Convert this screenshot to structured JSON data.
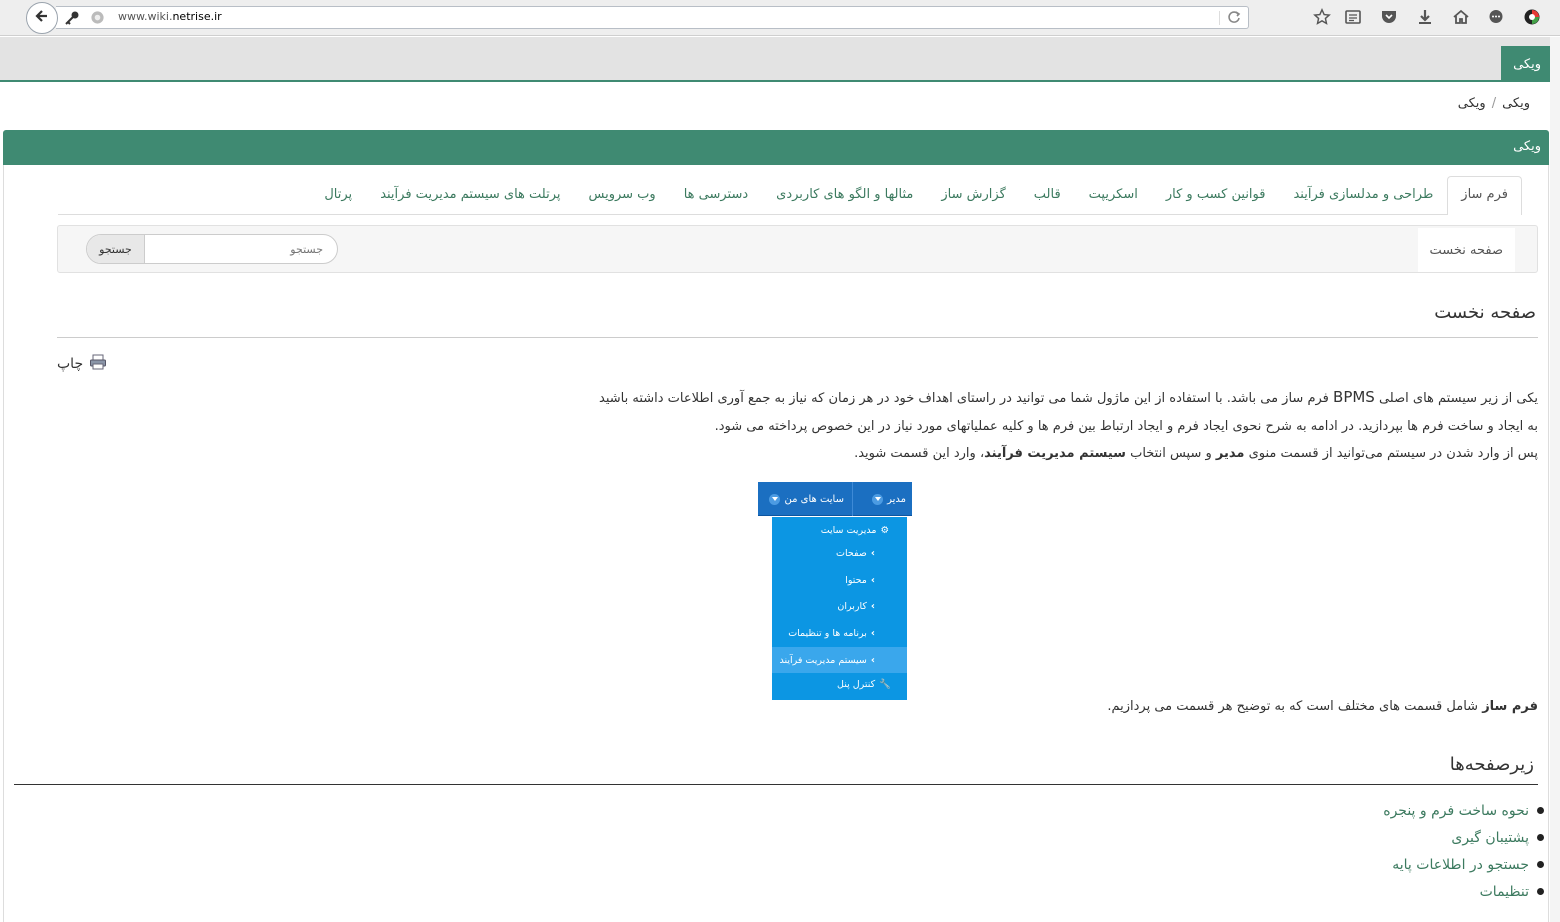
{
  "browser": {
    "url_prefix": "www.wiki.",
    "url_domain": "netrise.ir"
  },
  "topnav": {
    "tab": "ویکی"
  },
  "breadcrumb": {
    "items": [
      "ویکی",
      "ویکی"
    ],
    "sep": "/"
  },
  "panel": {
    "title": "ویکی"
  },
  "tabs": [
    "فرم ساز",
    "طراحی و مدلسازی فرآیند",
    "قوانین کسب و کار",
    "اسکریپت",
    "قالب",
    "گزارش ساز",
    "مثالها و الگو های کاربردی",
    "دسترسی ها",
    "وب سرویس",
    "پرتلت های سیستم مدیریت فرآیند",
    "پرتال"
  ],
  "subbar": {
    "home_label": "صفحه نخست",
    "search_placeholder": "جستجو",
    "search_button": "جستجو"
  },
  "page": {
    "title": "صفحه نخست",
    "print_label": "چاپ",
    "para1_a": "یکی از زیر سیستم های اصلی ",
    "para1_big": "BPMS",
    "para1_b": " فرم ساز می باشد. با استفاده از این ماژول شما می توانید در راستای اهداف خود در هر زمان که نیاز به جمع آوری اطلاعات داشته باشید",
    "para2": "به ایجاد و ساخت فرم ها بپردازید. در ادامه به شرح نحوی ایجاد فرم و ایجاد ارتباط بین فرم ها و کلیه عملیاتهای مورد نیاز در این خصوص پرداخته می شود.",
    "para3_a": "پس از وارد شدن در سیستم می‌توانید از قسمت  منوی ",
    "para3_b1": "مدیر",
    "para3_c": " و سپس انتخاب ",
    "para3_b2": "سیستم مدیریت فرآیند",
    "para3_d": "، وارد این قسمت شوید.",
    "para4_bold": "فرم ساز",
    "para4_rest": " شامل قسمت های مختلف است که به توضیح هر قسمت می پردازیم."
  },
  "menu_image": {
    "top_right": "مدیر",
    "top_left": "سایت های من",
    "items": [
      "مدیریت سایت",
      "صفحات",
      "محتوا",
      "کاربران",
      "برنامه ها و تنظیمات",
      "سیستم مدیریت فرآیند",
      "کنترل پنل"
    ]
  },
  "subpages": {
    "title": "زیرصفحه‌ها",
    "items": [
      "نحوه ساخت فرم و پنجره",
      "پشتیبان گیری",
      "جستجو در اطلاعات پایه",
      "تنظیمات"
    ]
  }
}
